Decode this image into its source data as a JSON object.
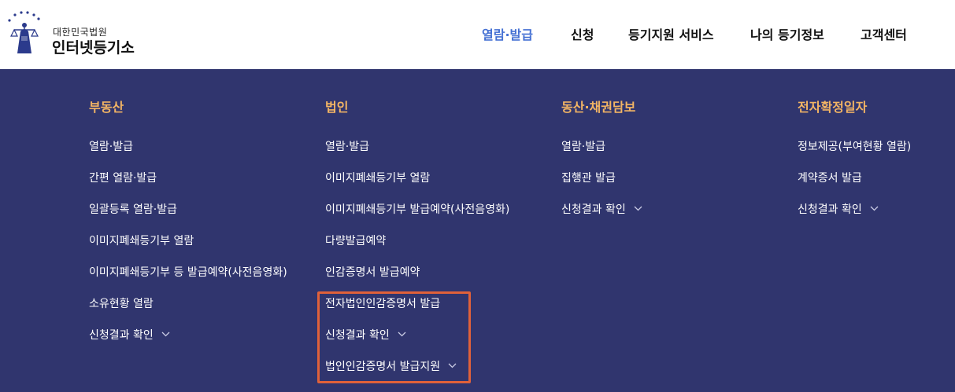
{
  "header": {
    "logo": {
      "org_name": "대한민국법원",
      "site_name": "인터넷등기소"
    },
    "nav": [
      {
        "label": "열람·발급",
        "active": true
      },
      {
        "label": "신청",
        "active": false
      },
      {
        "label": "등기지원 서비스",
        "active": false
      },
      {
        "label": "나의 등기정보",
        "active": false
      },
      {
        "label": "고객센터",
        "active": false
      }
    ]
  },
  "mega_menu": {
    "columns": [
      {
        "title": "부동산",
        "items": [
          {
            "label": "열람·발급",
            "has_submenu": false
          },
          {
            "label": "간편 열람·발급",
            "has_submenu": false
          },
          {
            "label": "일괄등록 열람·발급",
            "has_submenu": false
          },
          {
            "label": "이미지폐쇄등기부 열람",
            "has_submenu": false
          },
          {
            "label": "이미지폐쇄등기부 등 발급예약(사전음영화)",
            "has_submenu": false
          },
          {
            "label": "소유현황 열람",
            "has_submenu": false
          },
          {
            "label": "신청결과 확인",
            "has_submenu": true
          }
        ]
      },
      {
        "title": "법인",
        "items": [
          {
            "label": "열람·발급",
            "has_submenu": false
          },
          {
            "label": "이미지폐쇄등기부 열람",
            "has_submenu": false
          },
          {
            "label": "이미지폐쇄등기부 발급예약(사전음영화)",
            "has_submenu": false
          },
          {
            "label": "다량발급예약",
            "has_submenu": false
          },
          {
            "label": "인감증명서 발급예약",
            "has_submenu": false
          },
          {
            "label": "전자법인인감증명서 발급",
            "has_submenu": false
          },
          {
            "label": "신청결과 확인",
            "has_submenu": true
          },
          {
            "label": "법인인감증명서 발급지원",
            "has_submenu": true
          }
        ]
      },
      {
        "title": "동산·채권담보",
        "items": [
          {
            "label": "열람·발급",
            "has_submenu": false
          },
          {
            "label": "집행관 발급",
            "has_submenu": false
          },
          {
            "label": "신청결과 확인",
            "has_submenu": true
          }
        ]
      },
      {
        "title": "전자확정일자",
        "items": [
          {
            "label": "정보제공(부여현황 열람)",
            "has_submenu": false
          },
          {
            "label": "계약증서 발급",
            "has_submenu": false
          },
          {
            "label": "신청결과 확인",
            "has_submenu": true
          }
        ]
      }
    ]
  },
  "colors": {
    "menu_background": "#30356e",
    "column_title": "#f3b564",
    "active_nav": "#4470d3",
    "highlight_border": "#e0613a"
  }
}
